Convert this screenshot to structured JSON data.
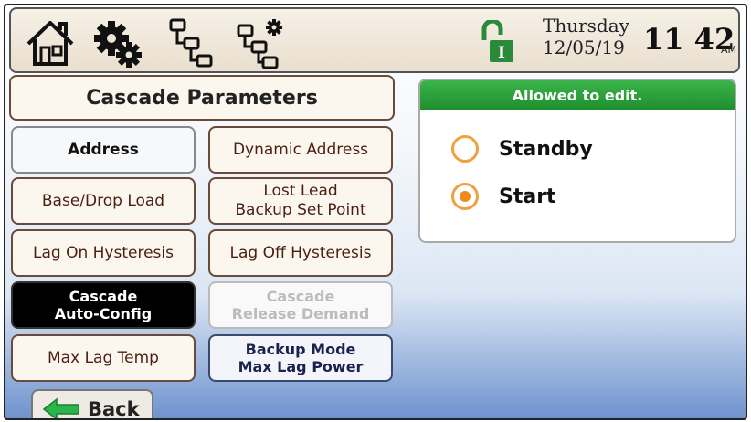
{
  "header": {
    "day": "Thursday",
    "date": "12/05/19",
    "time": "11 42",
    "ampm": "AM",
    "lock_badge": "I",
    "icons": [
      "home-icon",
      "settings-gears-icon",
      "cascade-network-icon",
      "cascade-network-settings-icon",
      "unlocked-padlock-icon"
    ]
  },
  "panel": {
    "title": "Cascade Parameters",
    "buttons": {
      "address": "Address",
      "dynamic_address": "Dynamic Address",
      "base_drop_load": "Base/Drop Load",
      "lost_lead_1": "Lost Lead",
      "lost_lead_2": "Backup Set Point",
      "lag_on": "Lag On Hysteresis",
      "lag_off": "Lag Off Hysteresis",
      "auto_config_1": "Cascade",
      "auto_config_2": "Auto-Config",
      "release_demand_1": "Cascade",
      "release_demand_2": "Release Demand",
      "max_lag_temp": "Max Lag Temp",
      "backup_mode_1": "Backup Mode",
      "backup_mode_2": "Max Lag Power"
    }
  },
  "edit": {
    "status": "Allowed to edit.",
    "options": [
      {
        "label": "Standby",
        "checked": false
      },
      {
        "label": "Start",
        "checked": true
      }
    ]
  },
  "footer": {
    "back_label": "Back"
  },
  "colors": {
    "accent_green": "#1f8f2e",
    "radio_orange": "#f08a1a",
    "button_border": "#6a4a3a",
    "back_arrow": "#2bb44a"
  }
}
